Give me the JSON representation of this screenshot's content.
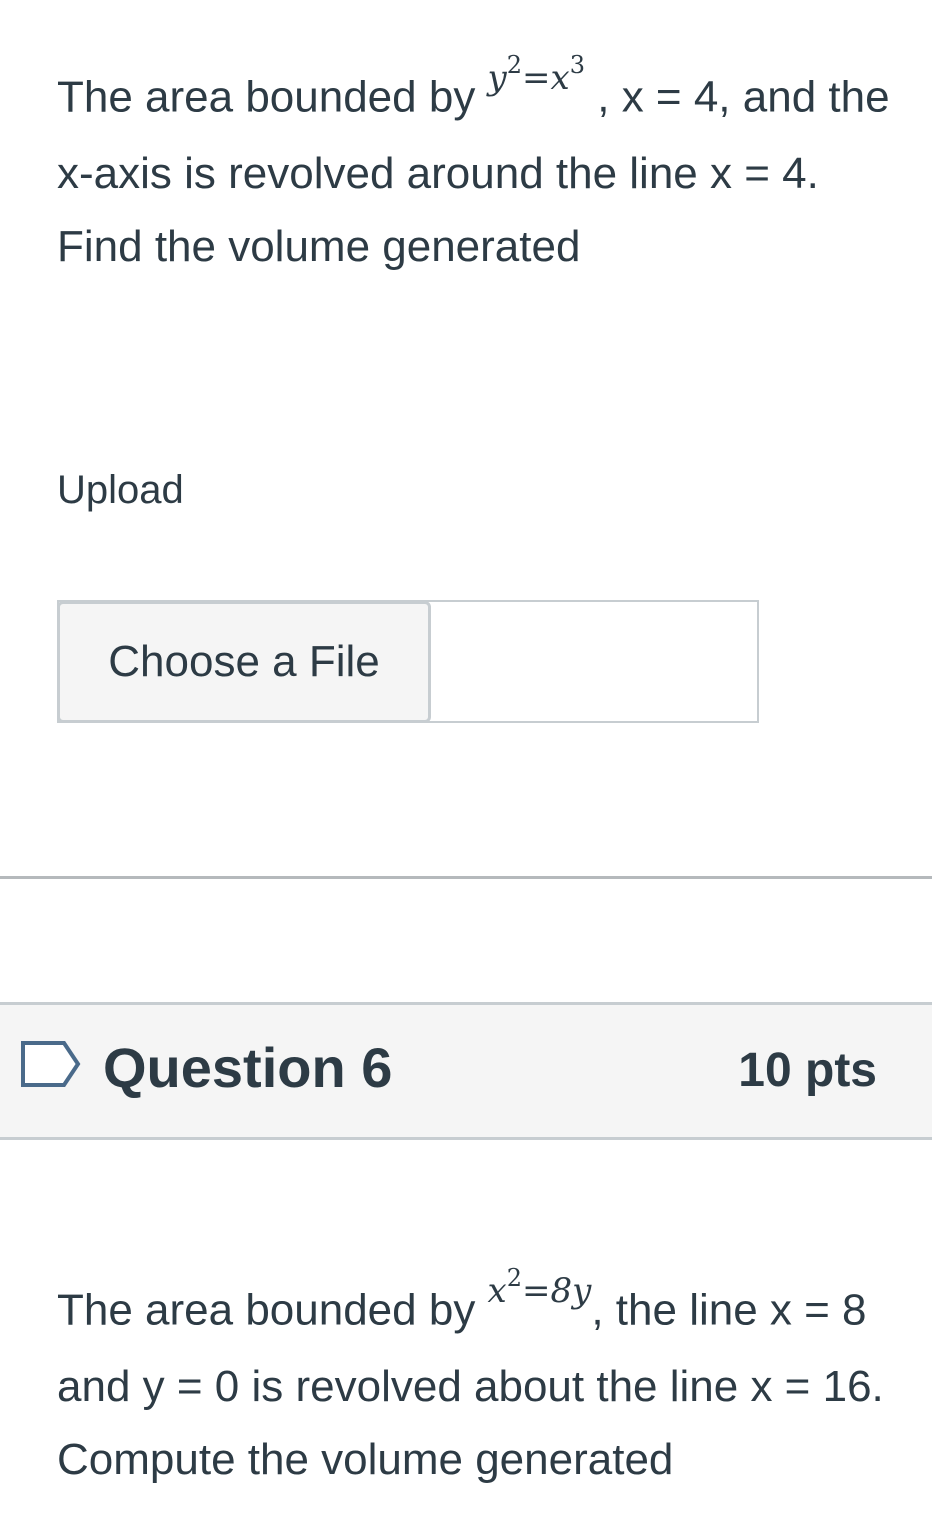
{
  "question5": {
    "text_part1": "The area bounded by ",
    "math": {
      "base1": "y",
      "exp1": "2",
      "eq": "=",
      "base2": "x",
      "exp2": "3"
    },
    "text_part2": " , x = 4, and the x-axis is revolved around the line x = 4. Find the volume generated"
  },
  "upload": {
    "label": "Upload",
    "button_label": "Choose a File",
    "file_name": ""
  },
  "question6": {
    "title": "Question 6",
    "points": "10 pts",
    "text_part1": "The area bounded by ",
    "math": {
      "base1": "x",
      "exp1": "2",
      "eq": "=",
      "rhs": "8y"
    },
    "text_part2": ", the line x = 8 and y = 0 is revolved about the line x = 16. Compute the volume generated"
  },
  "icons": {
    "flag": "flag-outline-icon"
  },
  "colors": {
    "text": "#2d3b45",
    "header_bg": "#f5f5f5",
    "border": "#c7cdd1",
    "flag_stroke": "#4a6a8a"
  }
}
